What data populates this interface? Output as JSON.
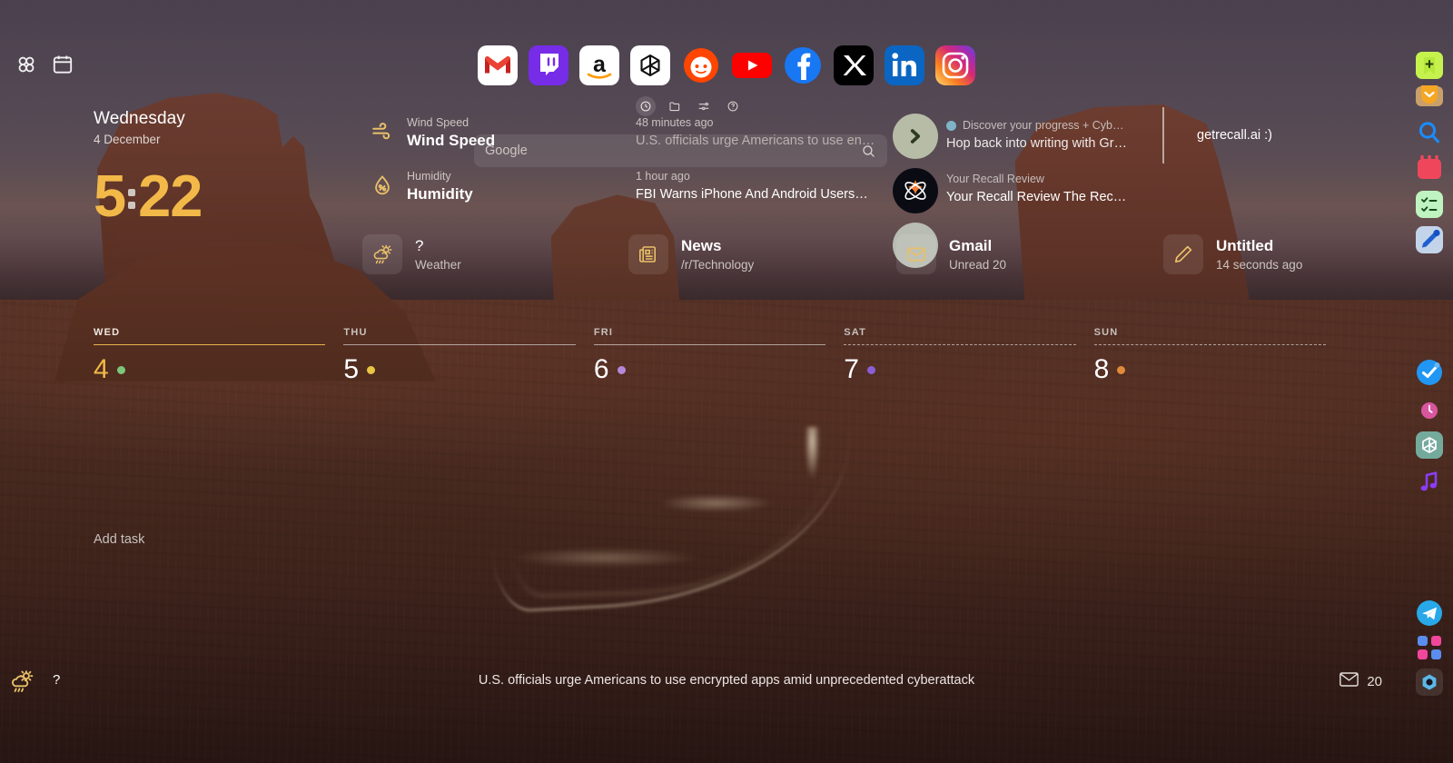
{
  "topbar": {
    "grid_icon": "grid-apps-icon",
    "calendar_icon": "calendar-icon"
  },
  "clock": {
    "day_name": "Wednesday",
    "date": "4 December",
    "hours": "5",
    "minutes": "22"
  },
  "weather_details": [
    {
      "icon": "wind-icon",
      "label": "Wind Speed",
      "value": "Wind Speed"
    },
    {
      "icon": "humidity-icon",
      "label": "Humidity",
      "value": "Humidity"
    }
  ],
  "search": {
    "placeholder": "Google",
    "value": "",
    "icon": "search-icon"
  },
  "mini_tools": [
    {
      "name": "recent-clock-icon",
      "active": true
    },
    {
      "name": "folder-icon",
      "active": false
    },
    {
      "name": "filter-sliders-icon",
      "active": false
    },
    {
      "name": "help-circle-icon",
      "active": false
    }
  ],
  "news": {
    "items": [
      {
        "time": "48 minutes ago",
        "title": "U.S. officials urge Americans to use en…"
      },
      {
        "time": "1 hour ago",
        "title": "FBI Warns iPhone And Android Users—…"
      }
    ]
  },
  "mail": {
    "items": [
      {
        "from": "Discover your progress + Cyb…",
        "subject": "Hop back into writing with Gram…",
        "favicon_color": "#7fb3c8"
      },
      {
        "from": "Your Recall Review",
        "subject": "Your Recall Review The Recall Re…",
        "favicon_color": "#ffffff"
      }
    ]
  },
  "note_preview": {
    "text": "getrecall.ai :)"
  },
  "cards": [
    {
      "name": "weather-card",
      "icon": "weather-sun-rain-icon",
      "title": "?",
      "subtitle": "Weather"
    },
    {
      "name": "news-card",
      "icon": "newspaper-icon",
      "title": "News",
      "subtitle": "/r/Technology"
    },
    {
      "name": "gmail-card",
      "icon": "envelope-icon",
      "title": "Gmail",
      "subtitle": "Unread 20"
    },
    {
      "name": "note-card",
      "icon": "pencil-icon",
      "title": "Untitled",
      "subtitle": "14 seconds ago"
    }
  ],
  "day_strip": [
    {
      "label": "WED",
      "number": "4",
      "dot_color": "#7bc67b",
      "today": true,
      "dotted": false
    },
    {
      "label": "THU",
      "number": "5",
      "dot_color": "#e8c544",
      "today": false,
      "dotted": false
    },
    {
      "label": "FRI",
      "number": "6",
      "dot_color": "#b488d8",
      "today": false,
      "dotted": false
    },
    {
      "label": "SAT",
      "number": "7",
      "dot_color": "#8a5fd4",
      "today": false,
      "dotted": true
    },
    {
      "label": "SUN",
      "number": "8",
      "dot_color": "#e08a3c",
      "today": false,
      "dotted": true
    }
  ],
  "tasks": {
    "add_label": "Add task"
  },
  "statusbar": {
    "weather_icon": "weather-sun-rain-icon",
    "temperature": "?",
    "ticker": "U.S. officials urge Americans to use encrypted apps amid unprecedented cyberattack",
    "mail_icon": "envelope-icon",
    "mail_count": "20"
  },
  "dock_apps": [
    {
      "name": "gmail",
      "label": "Gmail"
    },
    {
      "name": "twitch",
      "label": "Twitch"
    },
    {
      "name": "amazon",
      "label": "Amazon"
    },
    {
      "name": "chatgpt",
      "label": "ChatGPT"
    },
    {
      "name": "reddit",
      "label": "Reddit"
    },
    {
      "name": "youtube",
      "label": "YouTube"
    },
    {
      "name": "facebook",
      "label": "Facebook"
    },
    {
      "name": "x-twitter",
      "label": "X"
    },
    {
      "name": "linkedin",
      "label": "LinkedIn"
    },
    {
      "name": "instagram",
      "label": "Instagram"
    }
  ],
  "rail_apps": [
    {
      "name": "bookmark-add",
      "label": "Bookmark"
    },
    {
      "name": "pocket",
      "label": "Pocket"
    },
    {
      "name": "search-blue",
      "label": "Search"
    },
    {
      "name": "calendar-red",
      "label": "Calendar"
    },
    {
      "name": "tasks-green",
      "label": "Tasks"
    },
    {
      "name": "notes-pen",
      "label": "Notes"
    },
    {
      "name": "todoist",
      "label": "Todoist"
    },
    {
      "name": "clock-pink",
      "label": "Clock"
    },
    {
      "name": "chatgpt-rail",
      "label": "ChatGPT"
    },
    {
      "name": "music-note",
      "label": "Music"
    },
    {
      "name": "telegram",
      "label": "Telegram"
    },
    {
      "name": "apps-grid",
      "label": "Apps"
    },
    {
      "name": "settings-gear",
      "label": "Settings"
    }
  ],
  "colors": {
    "accent_gold": "#F2B949",
    "icon_gold": "#E8C06A",
    "text_primary": "#ffffff",
    "text_muted": "#c8c1bd"
  }
}
